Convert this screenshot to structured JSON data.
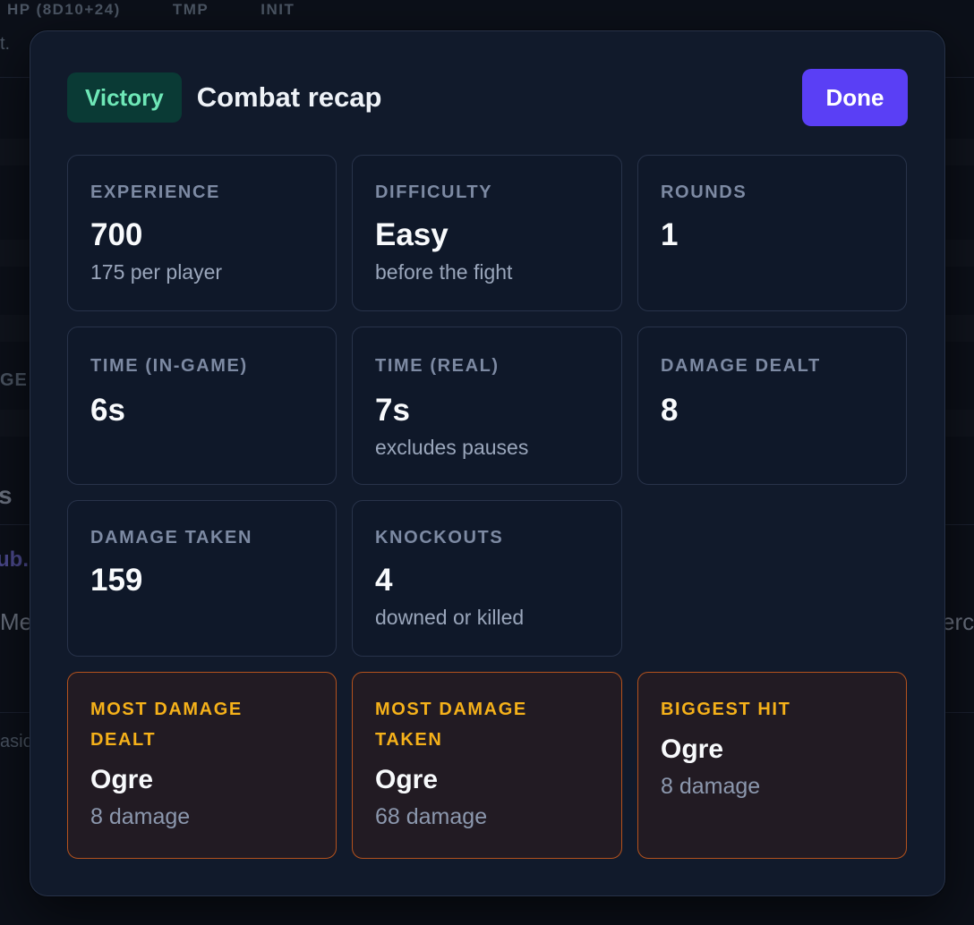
{
  "background": {
    "columns": [
      "HP (8D10+24)",
      "TMP",
      "INIT"
    ],
    "snippets": {
      "t": "t.",
      "ge": "GE",
      "s": "s",
      "ub": "ub.",
      "me": "Me",
      "erc": "erc",
      "asic": "asic"
    }
  },
  "modal": {
    "badge": "Victory",
    "title": "Combat recap",
    "done_label": "Done"
  },
  "stats": [
    {
      "label": "EXPERIENCE",
      "value": "700",
      "sub": "175 per player"
    },
    {
      "label": "DIFFICULTY",
      "value": "Easy",
      "sub": "before the fight"
    },
    {
      "label": "ROUNDS",
      "value": "1",
      "sub": ""
    },
    {
      "label": "TIME (IN-GAME)",
      "value": "6s",
      "sub": ""
    },
    {
      "label": "TIME (REAL)",
      "value": "7s",
      "sub": "excludes pauses"
    },
    {
      "label": "DAMAGE DEALT",
      "value": "8",
      "sub": ""
    },
    {
      "label": "DAMAGE TAKEN",
      "value": "159",
      "sub": ""
    },
    {
      "label": "KNOCKOUTS",
      "value": "4",
      "sub": "downed or killed"
    }
  ],
  "highlights": [
    {
      "label": "MOST DAMAGE DEALT",
      "value": "Ogre",
      "sub": "8 damage"
    },
    {
      "label": "MOST DAMAGE TAKEN",
      "value": "Ogre",
      "sub": "68 damage"
    },
    {
      "label": "BIGGEST HIT",
      "value": "Ogre",
      "sub": "8 damage"
    }
  ],
  "colors": {
    "victory_bg": "#0a3a35",
    "victory_text": "#6ee7b7",
    "done_button": "#5a3ff5",
    "highlight_label": "#f5b11a",
    "highlight_border": "#b4521d"
  }
}
